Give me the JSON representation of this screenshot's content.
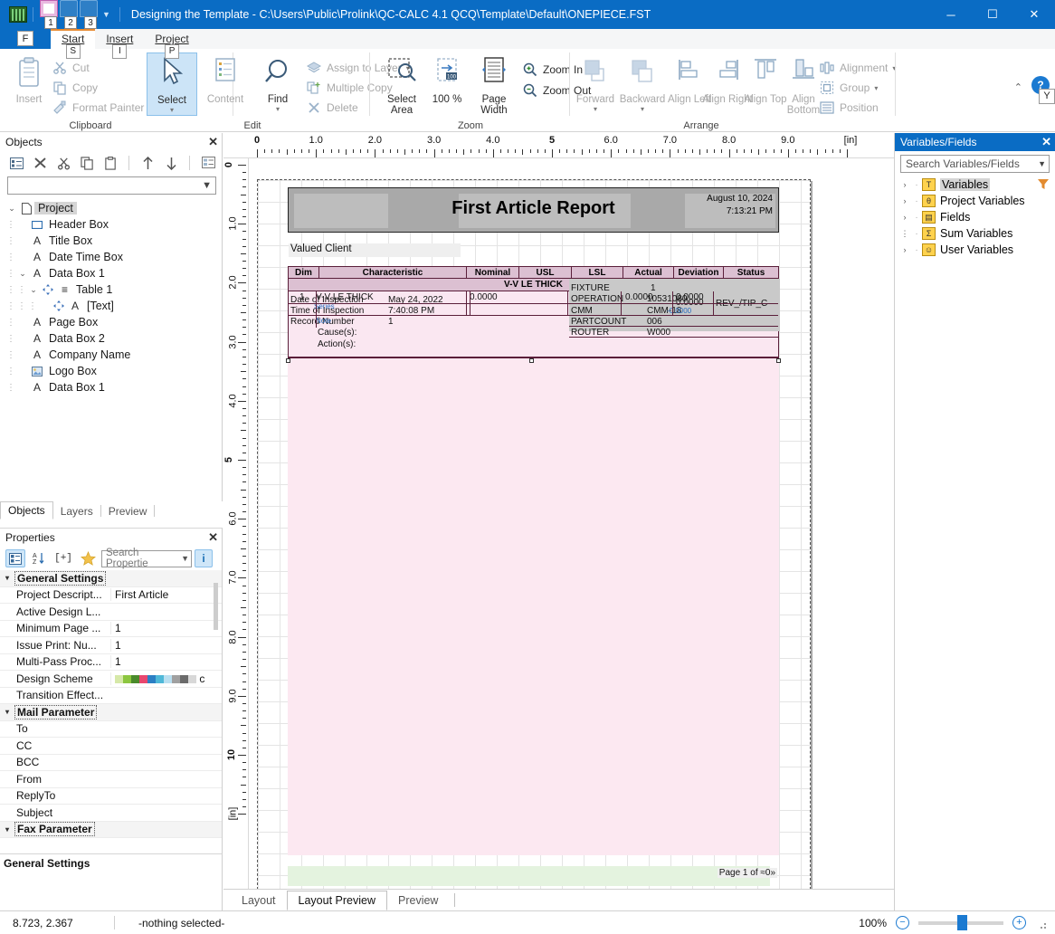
{
  "titlebar": {
    "title": "Designing the Template - C:\\Users\\Public\\Prolink\\QC-CALC 4.1 QCQ\\Template\\Default\\ONEPIECE.FST",
    "qat_keytips": [
      "1",
      "2",
      "3"
    ],
    "minimize": "─",
    "maximize": "☐",
    "close": "✕"
  },
  "ribbon": {
    "file_tab": "F",
    "tabs": [
      {
        "label": "Start",
        "keytip": "S",
        "active": true
      },
      {
        "label": "Insert",
        "keytip": "I",
        "active": false
      },
      {
        "label": "Project",
        "keytip": "P",
        "active": false
      }
    ],
    "collapse_icon": "⌃",
    "help_icon": "?",
    "help_keytip": "Y",
    "groups": [
      {
        "name": "Clipboard",
        "big": [
          {
            "label": "Insert",
            "icon": "clipboard-icon",
            "disabled": true
          }
        ],
        "small": [
          {
            "label": "Cut",
            "icon": "scissors-icon",
            "disabled": true
          },
          {
            "label": "Copy",
            "icon": "copy-icon",
            "disabled": true
          },
          {
            "label": "Format Painter",
            "icon": "format-painter-icon",
            "disabled": true
          }
        ]
      },
      {
        "name": "Edit",
        "big": [
          {
            "label": "Select",
            "icon": "cursor-icon",
            "selected": true,
            "caret": "▾"
          },
          {
            "label": "Content",
            "icon": "content-icon",
            "disabled": true
          },
          {
            "label": "Find",
            "icon": "magnifier-icon",
            "caret": "▾"
          }
        ],
        "small": [
          {
            "label": "Assign to Layer",
            "icon": "layers-icon",
            "disabled": true,
            "caret": "▾"
          },
          {
            "label": "Multiple Copy",
            "icon": "multi-copy-icon",
            "disabled": true
          },
          {
            "label": "Delete",
            "icon": "delete-x-icon",
            "disabled": true
          }
        ]
      },
      {
        "name": "Zoom",
        "big": [
          {
            "label": "Select Area",
            "icon": "select-area-icon"
          },
          {
            "label": "100 %",
            "icon": "zoom-100-icon"
          },
          {
            "label": "Page Width",
            "icon": "page-width-icon"
          }
        ],
        "small": [
          {
            "label": "Zoom In",
            "icon": "zoom-in-icon"
          },
          {
            "label": "Zoom Out",
            "icon": "zoom-out-icon"
          }
        ]
      },
      {
        "name": "Arrange",
        "big": [
          {
            "label": "Forward",
            "icon": "bring-forward-icon",
            "disabled": true,
            "caret": "▾"
          },
          {
            "label": "Backward",
            "icon": "send-backward-icon",
            "disabled": true,
            "caret": "▾"
          },
          {
            "label": "Align Left",
            "icon": "align-left-icon",
            "disabled": true
          },
          {
            "label": "Align Right",
            "icon": "align-right-icon",
            "disabled": true
          },
          {
            "label": "Align Top",
            "icon": "align-top-icon",
            "disabled": true
          },
          {
            "label": "Align Bottom",
            "icon": "align-bottom-icon",
            "disabled": true
          }
        ],
        "small": [
          {
            "label": "Alignment",
            "icon": "alignment-icon",
            "disabled": true,
            "caret": "▾"
          },
          {
            "label": "Group",
            "icon": "group-icon",
            "disabled": true,
            "caret": "▾"
          },
          {
            "label": "Position",
            "icon": "position-icon",
            "disabled": true
          }
        ]
      }
    ]
  },
  "objects_panel": {
    "title": "Objects",
    "close": "✕",
    "toolbar_icons": [
      "properties-icon",
      "delete-icon",
      "cut-icon",
      "copy-icon",
      "paste-icon",
      "move-up-icon",
      "move-down-icon",
      "object-list-icon"
    ],
    "combo_value": "",
    "tree": [
      {
        "label": "Project",
        "icon": "page-icon",
        "depth": 0,
        "expander": "⌄",
        "selected": true
      },
      {
        "label": "Header Box",
        "icon": "rect-icon",
        "depth": 1,
        "expander": ""
      },
      {
        "label": "Title Box",
        "icon": "A",
        "depth": 1,
        "expander": ""
      },
      {
        "label": "Date Time Box",
        "icon": "A",
        "depth": 1,
        "expander": ""
      },
      {
        "label": "Data Box 1",
        "icon": "A",
        "depth": 1,
        "expander": "⌄"
      },
      {
        "label": "Table 1",
        "icon": "table-icon",
        "depth": 2,
        "expander": "⌄"
      },
      {
        "label": "[Text]",
        "icon": "A",
        "depth": 3,
        "expander": ""
      },
      {
        "label": "Page Box",
        "icon": "A",
        "depth": 1,
        "expander": ""
      },
      {
        "label": "Data Box 2",
        "icon": "A",
        "depth": 1,
        "expander": ""
      },
      {
        "label": "Company Name",
        "icon": "A",
        "depth": 1,
        "expander": ""
      },
      {
        "label": "Logo Box",
        "icon": "image-icon",
        "depth": 1,
        "expander": ""
      },
      {
        "label": "Data Box 1",
        "icon": "A",
        "depth": 1,
        "expander": ""
      }
    ]
  },
  "dock_tabs": [
    {
      "label": "Objects",
      "active": true
    },
    {
      "label": "Layers",
      "active": false
    },
    {
      "label": "Preview",
      "active": false
    }
  ],
  "properties_panel": {
    "title": "Properties",
    "close": "✕",
    "toolbar": {
      "categorized_icon": "categorized-view-icon",
      "sort_icon": "sort-az-icon",
      "expand_label": "[+]",
      "favorites_icon": "star-icon",
      "search_placeholder": "Search Propertie",
      "info_icon": "info-icon"
    },
    "rows": [
      {
        "category": true,
        "name": "General Settings",
        "value": ""
      },
      {
        "category": false,
        "name": "Project Descript...",
        "value": "First Article"
      },
      {
        "category": false,
        "name": "Active Design L...",
        "value": ""
      },
      {
        "category": false,
        "name": "Minimum Page ...",
        "value": "1"
      },
      {
        "category": false,
        "name": "Issue Print: Nu...",
        "value": "1"
      },
      {
        "category": false,
        "name": "Multi-Pass Proc...",
        "value": "1"
      },
      {
        "category": false,
        "name": "Design Scheme",
        "value": "c",
        "swatches": [
          "#d6e8a8",
          "#8cc63f",
          "#4a8a2b",
          "#e8476e",
          "#2b7fc4",
          "#4fb8d8",
          "#b9dff0",
          "#a0a0a0",
          "#6b6b6b",
          "#d8d8d8"
        ]
      },
      {
        "category": false,
        "name": "Transition Effect...",
        "value": ""
      },
      {
        "category": true,
        "name": "Mail Parameter",
        "value": ""
      },
      {
        "category": false,
        "name": "To",
        "value": ""
      },
      {
        "category": false,
        "name": "CC",
        "value": ""
      },
      {
        "category": false,
        "name": "BCC",
        "value": ""
      },
      {
        "category": false,
        "name": "From",
        "value": ""
      },
      {
        "category": false,
        "name": "ReplyTo",
        "value": ""
      },
      {
        "category": false,
        "name": "Subject",
        "value": ""
      },
      {
        "category": true,
        "name": "Fax Parameter",
        "value": ""
      }
    ],
    "status_label": "General Settings"
  },
  "variables_panel": {
    "title": "Variables/Fields",
    "close": "✕",
    "search_placeholder": "Search Variables/Fields",
    "filter_icon": "filter-icon",
    "items": [
      {
        "label": "Variables",
        "icon_letter": "T",
        "expander": "›",
        "selected": true
      },
      {
        "label": "Project Variables",
        "icon_letter": "θ",
        "expander": "›",
        "selected": false
      },
      {
        "label": "Fields",
        "icon_letter": "▤",
        "expander": "›",
        "selected": false
      },
      {
        "label": "Sum Variables",
        "icon_letter": "Σ",
        "expander": "",
        "selected": false
      },
      {
        "label": "User Variables",
        "icon_letter": "☺",
        "expander": "›",
        "selected": false
      }
    ]
  },
  "workspace": {
    "ruler_unit": "[in]",
    "ruler_h_labels": [
      "0",
      "1.0",
      "2.0",
      "3.0",
      "4.0",
      "5",
      "6.0",
      "7.0",
      "8.0",
      "9.0"
    ],
    "ruler_v_labels": [
      "0",
      "1.0",
      "2.0",
      "3.0",
      "4.0",
      "5",
      "6.0",
      "7.0",
      "8.0",
      "9.0",
      "10"
    ]
  },
  "report": {
    "title": "First Article Report",
    "date": "August 10, 2024",
    "time": "7:13:21 PM",
    "client": "Valued Client",
    "columns": [
      "Dim",
      "Characteristic",
      "Nominal",
      "USL",
      "LSL",
      "Actual",
      "Deviation",
      "Status"
    ],
    "group_row": "V-V LE THICK",
    "overlay_left": [
      {
        "label": "Date of Inspection",
        "value": "May 24, 2022"
      },
      {
        "label": "Time of Inspection",
        "value": "7:40:08 PM"
      },
      {
        "label": "Record Number",
        "value": "1"
      },
      {
        "label": "Cause(s):",
        "value": ""
      },
      {
        "label": "Action(s):",
        "value": ""
      }
    ],
    "overlay_right": [
      {
        "label": "FIXTURE",
        "value": "1"
      },
      {
        "label": "OPERATION",
        "value": "10531080"
      },
      {
        "label": "CMM",
        "value": "CMM-18"
      },
      {
        "label": "PARTCOUNT",
        "value": "006"
      },
      {
        "label": "ROUTER",
        "value": "W000"
      }
    ],
    "data_row": {
      "dim": "1",
      "characteristic": "V-V LE THICK",
      "nominal": "0.0000",
      "usl": "",
      "lsl": "0.0000",
      "actual": "0.0000",
      "deviation": "0.0000",
      "status": "REV_/TIP_C"
    },
    "blue_labels": [
      "Series",
      "Note",
      "0.0000",
      "-0.0000",
      "0.000"
    ],
    "page_footer": "Page  1  of  ≈0»"
  },
  "view_tabs": [
    {
      "label": "Layout",
      "active": false
    },
    {
      "label": "Layout Preview",
      "active": true
    },
    {
      "label": "Preview",
      "active": false
    }
  ],
  "statusbar": {
    "coords": "8.723, 2.367",
    "selection": "-nothing selected-",
    "zoom": "100%",
    "zoom_out": "−",
    "zoom_in": "+"
  },
  "colors": {
    "accent": "#0a6cc4",
    "ribbon_selected": "#cce4f7",
    "table_header": "#dcc0d2",
    "band_pink": "#fce8f1",
    "band_green": "#e4f3df"
  }
}
